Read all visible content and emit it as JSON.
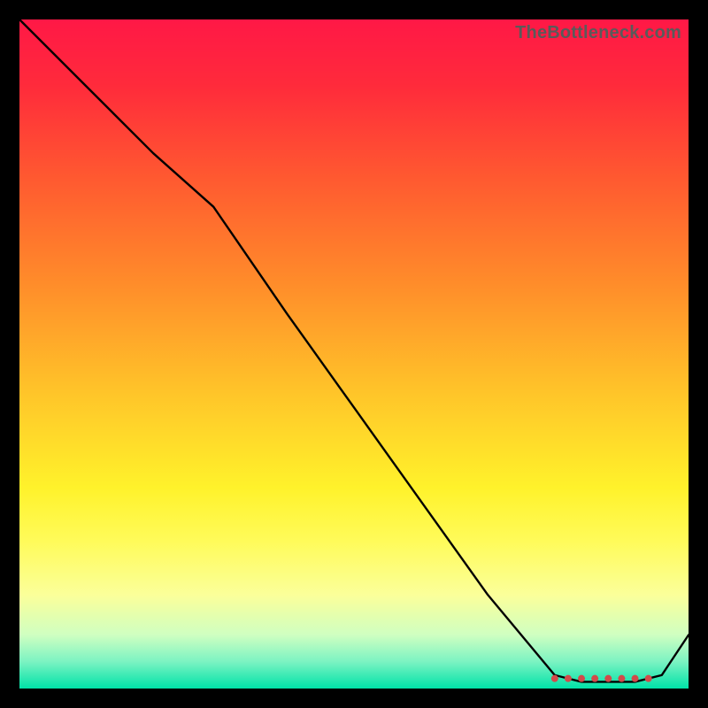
{
  "watermark": "TheBottleneck.com",
  "chart_data": {
    "type": "line",
    "title": "",
    "xlabel": "",
    "ylabel": "",
    "xlim": [
      0,
      100
    ],
    "ylim": [
      0,
      100
    ],
    "series": [
      {
        "name": "bottleneck-curve",
        "x": [
          0,
          10,
          20,
          29,
          40,
          50,
          60,
          70,
          80,
          84,
          88,
          92,
          96,
          100
        ],
        "values": [
          100,
          90,
          80,
          72,
          56,
          42,
          28,
          14,
          2,
          1,
          1,
          1,
          2,
          8
        ]
      }
    ],
    "markers": {
      "name": "optimal-range-dots",
      "x": [
        80,
        82,
        84,
        86,
        88,
        90,
        92,
        94
      ],
      "values": [
        1.5,
        1.5,
        1.5,
        1.5,
        1.5,
        1.5,
        1.5,
        1.5
      ]
    }
  },
  "colors": {
    "curve": "#000000",
    "marker": "#d24a4a"
  }
}
